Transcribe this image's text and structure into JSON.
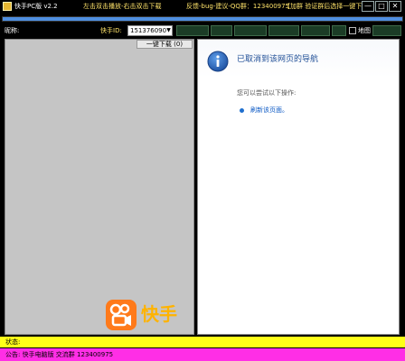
{
  "titlebar": {
    "app_title": "快手PC版 v2.2",
    "instruction": "左击双击播放-右击双击下载",
    "contact": "反馈-bug-建议-QQ群：123400975",
    "group_note": "【加群 验证群后选择一键下载】",
    "min_label": "—",
    "max_label": "□",
    "close_label": "✕"
  },
  "progress": {
    "value": 1.0,
    "color": "#4f8fe0"
  },
  "toolbar": {
    "keyword_label": "昵称:",
    "kuaishou_id_label": "快手ID:",
    "id_value": "151376090",
    "checkbox_label": "地图"
  },
  "left_panel": {
    "download_button": "一键下载 (0)",
    "logo_text": "快手",
    "logo_icon": "kuaishou-camera-icon",
    "logo_color": "#ffb300"
  },
  "right_panel": {
    "title": "已取消到该网页的导航",
    "subtitle": "您可以尝试以下操作:",
    "refresh_link": "刷新该页面。",
    "info_icon": "info-icon"
  },
  "status": {
    "label": "状态:",
    "notice": "公告: 快手电脑版 交流群 123400975",
    "status_color": "#ffff18",
    "notice_color": "#ff2ee6"
  }
}
